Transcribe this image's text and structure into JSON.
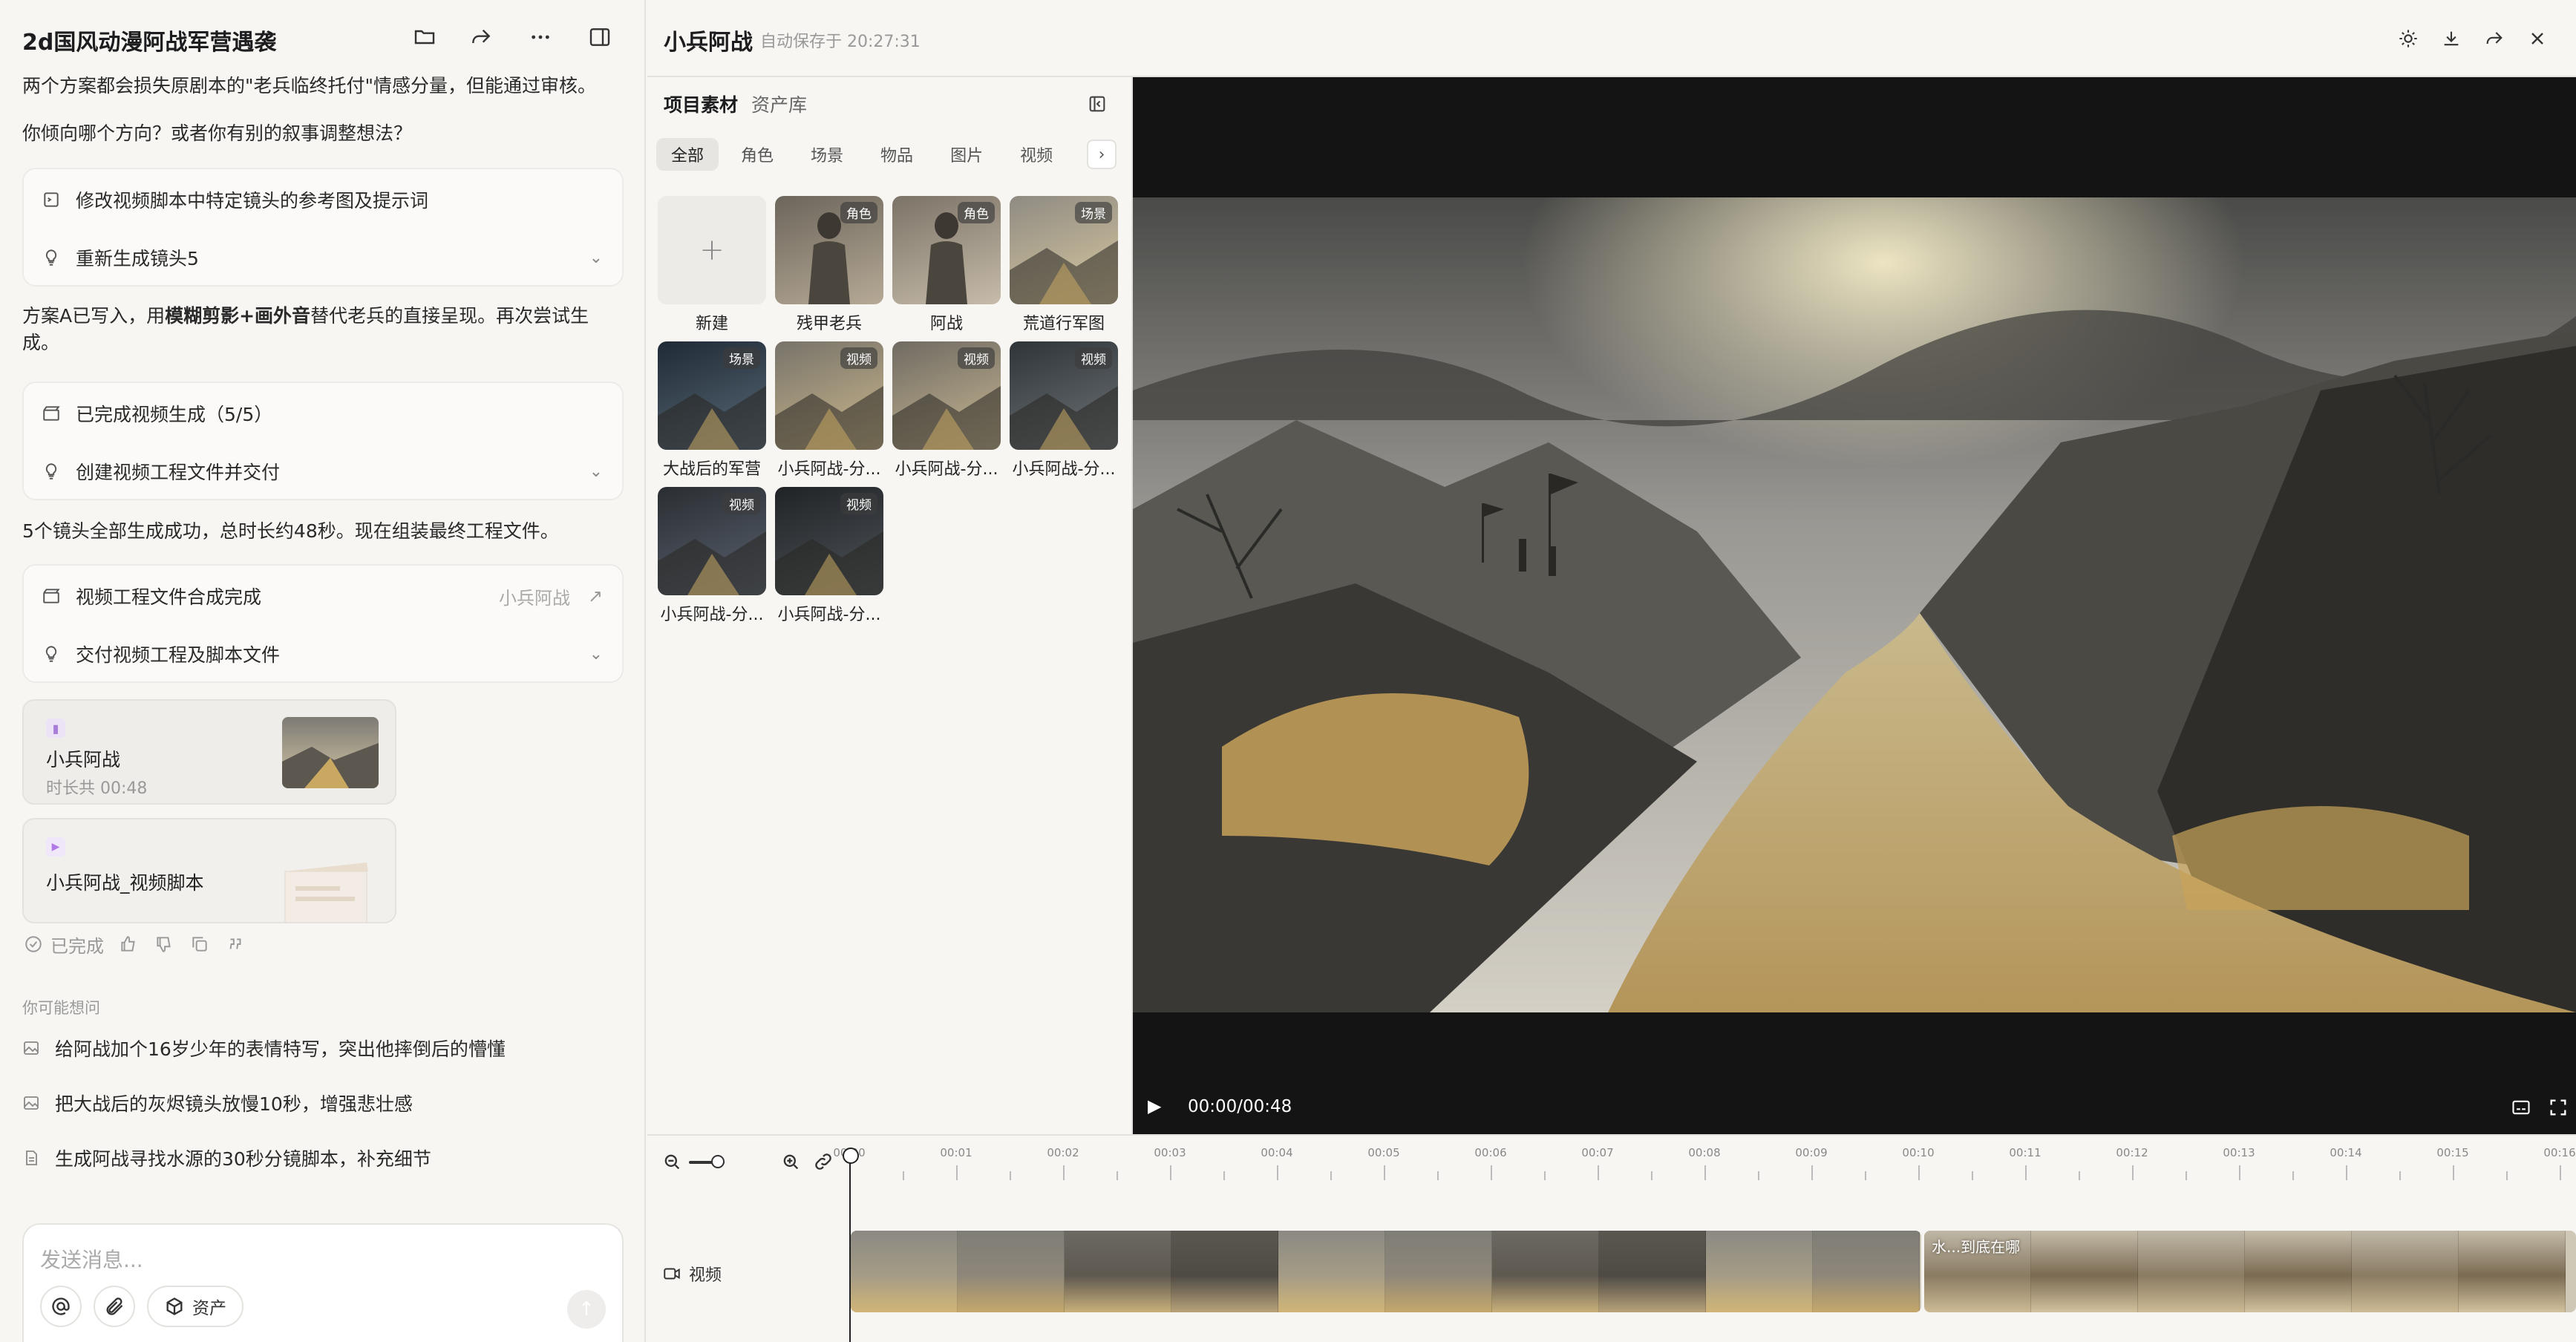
{
  "chat": {
    "title": "2d国风动漫阿战军营遇袭",
    "intro_line": "两个方案都会损失原剧本的\"老兵临终托付\"情感分量，但能通过审核。",
    "question_line": "你倾向哪个方向？或者你有别的叙事调整想法？",
    "card1": {
      "row1": "修改视频脚本中特定镜头的参考图及提示词",
      "row2": "重新生成镜头5"
    },
    "para2_part1": "方案A已写入，用",
    "para2_bold": "模糊剪影+画外音",
    "para2_part2": "替代老兵的直接呈现。再次尝试生成。",
    "card2": {
      "row1": "已完成视频生成（5/5）",
      "row2": "创建视频工程文件并交付"
    },
    "para3": "5个镜头全部生成成功，总时长约48秒。现在组装最终工程文件。",
    "card3": {
      "row1": "视频工程文件合成完成",
      "row1_sub": "小兵阿战",
      "row2": "交付视频工程及脚本文件"
    },
    "file1": {
      "name": "小兵阿战",
      "meta": "时长共 00:48"
    },
    "file2": {
      "name": "小兵阿战_视频脚本"
    },
    "done_label": "已完成",
    "suggest_heading": "你可能想问",
    "suggestions": [
      "给阿战加个16岁少年的表情特写，突出他摔倒后的懵懂",
      "把大战后的灰烬镜头放慢10秒，增强悲壮感",
      "生成阿战寻找水源的30秒分镜脚本，补充细节"
    ],
    "composer": {
      "placeholder": "发送消息...",
      "asset_label": "资产"
    }
  },
  "topbar": {
    "title": "小兵阿战",
    "saved": "自动保存于 20:27:31"
  },
  "assets": {
    "tab_project": "项目素材",
    "tab_library": "资产库",
    "filters": [
      "全部",
      "角色",
      "场景",
      "物品",
      "图片",
      "视频"
    ],
    "tiles": [
      {
        "caption": "新建",
        "badge": ""
      },
      {
        "caption": "残甲老兵",
        "badge": "角色"
      },
      {
        "caption": "阿战",
        "badge": "角色"
      },
      {
        "caption": "荒道行军图",
        "badge": "场景"
      },
      {
        "caption": "大战后的军营",
        "badge": "场景"
      },
      {
        "caption": "小兵阿战-分...",
        "badge": "视频"
      },
      {
        "caption": "小兵阿战-分...",
        "badge": "视频"
      },
      {
        "caption": "小兵阿战-分...",
        "badge": "视频"
      },
      {
        "caption": "小兵阿战-分...",
        "badge": "视频"
      },
      {
        "caption": "小兵阿战-分...",
        "badge": "视频"
      }
    ]
  },
  "preview": {
    "timecode": "00:00/00:48"
  },
  "timeline": {
    "ticks": [
      "00:00",
      "00:01",
      "00:02",
      "00:03",
      "00:04",
      "00:05",
      "00:06",
      "00:07",
      "00:08",
      "00:09",
      "00:10",
      "00:11",
      "00:12",
      "00:13",
      "00:14",
      "00:15",
      "00:16"
    ],
    "track_label": "视频",
    "clip2_title": "水...到底在哪"
  }
}
